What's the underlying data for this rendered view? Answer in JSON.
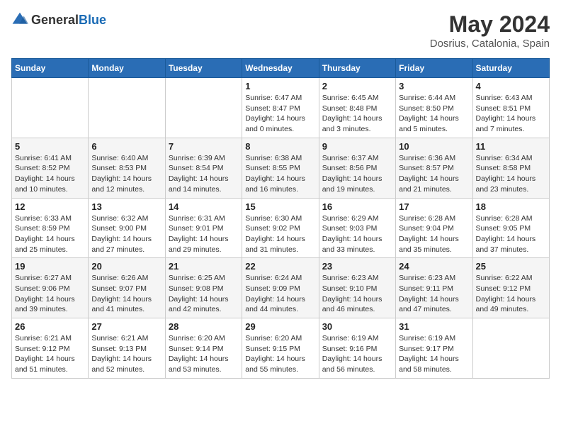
{
  "header": {
    "logo_general": "General",
    "logo_blue": "Blue",
    "main_title": "May 2024",
    "subtitle": "Dosrius, Catalonia, Spain"
  },
  "calendar": {
    "days_of_week": [
      "Sunday",
      "Monday",
      "Tuesday",
      "Wednesday",
      "Thursday",
      "Friday",
      "Saturday"
    ],
    "weeks": [
      [
        {
          "day": "",
          "sunrise": "",
          "sunset": "",
          "daylight": ""
        },
        {
          "day": "",
          "sunrise": "",
          "sunset": "",
          "daylight": ""
        },
        {
          "day": "",
          "sunrise": "",
          "sunset": "",
          "daylight": ""
        },
        {
          "day": "1",
          "sunrise": "Sunrise: 6:47 AM",
          "sunset": "Sunset: 8:47 PM",
          "daylight": "Daylight: 14 hours and 0 minutes."
        },
        {
          "day": "2",
          "sunrise": "Sunrise: 6:45 AM",
          "sunset": "Sunset: 8:48 PM",
          "daylight": "Daylight: 14 hours and 3 minutes."
        },
        {
          "day": "3",
          "sunrise": "Sunrise: 6:44 AM",
          "sunset": "Sunset: 8:50 PM",
          "daylight": "Daylight: 14 hours and 5 minutes."
        },
        {
          "day": "4",
          "sunrise": "Sunrise: 6:43 AM",
          "sunset": "Sunset: 8:51 PM",
          "daylight": "Daylight: 14 hours and 7 minutes."
        }
      ],
      [
        {
          "day": "5",
          "sunrise": "Sunrise: 6:41 AM",
          "sunset": "Sunset: 8:52 PM",
          "daylight": "Daylight: 14 hours and 10 minutes."
        },
        {
          "day": "6",
          "sunrise": "Sunrise: 6:40 AM",
          "sunset": "Sunset: 8:53 PM",
          "daylight": "Daylight: 14 hours and 12 minutes."
        },
        {
          "day": "7",
          "sunrise": "Sunrise: 6:39 AM",
          "sunset": "Sunset: 8:54 PM",
          "daylight": "Daylight: 14 hours and 14 minutes."
        },
        {
          "day": "8",
          "sunrise": "Sunrise: 6:38 AM",
          "sunset": "Sunset: 8:55 PM",
          "daylight": "Daylight: 14 hours and 16 minutes."
        },
        {
          "day": "9",
          "sunrise": "Sunrise: 6:37 AM",
          "sunset": "Sunset: 8:56 PM",
          "daylight": "Daylight: 14 hours and 19 minutes."
        },
        {
          "day": "10",
          "sunrise": "Sunrise: 6:36 AM",
          "sunset": "Sunset: 8:57 PM",
          "daylight": "Daylight: 14 hours and 21 minutes."
        },
        {
          "day": "11",
          "sunrise": "Sunrise: 6:34 AM",
          "sunset": "Sunset: 8:58 PM",
          "daylight": "Daylight: 14 hours and 23 minutes."
        }
      ],
      [
        {
          "day": "12",
          "sunrise": "Sunrise: 6:33 AM",
          "sunset": "Sunset: 8:59 PM",
          "daylight": "Daylight: 14 hours and 25 minutes."
        },
        {
          "day": "13",
          "sunrise": "Sunrise: 6:32 AM",
          "sunset": "Sunset: 9:00 PM",
          "daylight": "Daylight: 14 hours and 27 minutes."
        },
        {
          "day": "14",
          "sunrise": "Sunrise: 6:31 AM",
          "sunset": "Sunset: 9:01 PM",
          "daylight": "Daylight: 14 hours and 29 minutes."
        },
        {
          "day": "15",
          "sunrise": "Sunrise: 6:30 AM",
          "sunset": "Sunset: 9:02 PM",
          "daylight": "Daylight: 14 hours and 31 minutes."
        },
        {
          "day": "16",
          "sunrise": "Sunrise: 6:29 AM",
          "sunset": "Sunset: 9:03 PM",
          "daylight": "Daylight: 14 hours and 33 minutes."
        },
        {
          "day": "17",
          "sunrise": "Sunrise: 6:28 AM",
          "sunset": "Sunset: 9:04 PM",
          "daylight": "Daylight: 14 hours and 35 minutes."
        },
        {
          "day": "18",
          "sunrise": "Sunrise: 6:28 AM",
          "sunset": "Sunset: 9:05 PM",
          "daylight": "Daylight: 14 hours and 37 minutes."
        }
      ],
      [
        {
          "day": "19",
          "sunrise": "Sunrise: 6:27 AM",
          "sunset": "Sunset: 9:06 PM",
          "daylight": "Daylight: 14 hours and 39 minutes."
        },
        {
          "day": "20",
          "sunrise": "Sunrise: 6:26 AM",
          "sunset": "Sunset: 9:07 PM",
          "daylight": "Daylight: 14 hours and 41 minutes."
        },
        {
          "day": "21",
          "sunrise": "Sunrise: 6:25 AM",
          "sunset": "Sunset: 9:08 PM",
          "daylight": "Daylight: 14 hours and 42 minutes."
        },
        {
          "day": "22",
          "sunrise": "Sunrise: 6:24 AM",
          "sunset": "Sunset: 9:09 PM",
          "daylight": "Daylight: 14 hours and 44 minutes."
        },
        {
          "day": "23",
          "sunrise": "Sunrise: 6:23 AM",
          "sunset": "Sunset: 9:10 PM",
          "daylight": "Daylight: 14 hours and 46 minutes."
        },
        {
          "day": "24",
          "sunrise": "Sunrise: 6:23 AM",
          "sunset": "Sunset: 9:11 PM",
          "daylight": "Daylight: 14 hours and 47 minutes."
        },
        {
          "day": "25",
          "sunrise": "Sunrise: 6:22 AM",
          "sunset": "Sunset: 9:12 PM",
          "daylight": "Daylight: 14 hours and 49 minutes."
        }
      ],
      [
        {
          "day": "26",
          "sunrise": "Sunrise: 6:21 AM",
          "sunset": "Sunset: 9:12 PM",
          "daylight": "Daylight: 14 hours and 51 minutes."
        },
        {
          "day": "27",
          "sunrise": "Sunrise: 6:21 AM",
          "sunset": "Sunset: 9:13 PM",
          "daylight": "Daylight: 14 hours and 52 minutes."
        },
        {
          "day": "28",
          "sunrise": "Sunrise: 6:20 AM",
          "sunset": "Sunset: 9:14 PM",
          "daylight": "Daylight: 14 hours and 53 minutes."
        },
        {
          "day": "29",
          "sunrise": "Sunrise: 6:20 AM",
          "sunset": "Sunset: 9:15 PM",
          "daylight": "Daylight: 14 hours and 55 minutes."
        },
        {
          "day": "30",
          "sunrise": "Sunrise: 6:19 AM",
          "sunset": "Sunset: 9:16 PM",
          "daylight": "Daylight: 14 hours and 56 minutes."
        },
        {
          "day": "31",
          "sunrise": "Sunrise: 6:19 AM",
          "sunset": "Sunset: 9:17 PM",
          "daylight": "Daylight: 14 hours and 58 minutes."
        },
        {
          "day": "",
          "sunrise": "",
          "sunset": "",
          "daylight": ""
        }
      ]
    ]
  }
}
